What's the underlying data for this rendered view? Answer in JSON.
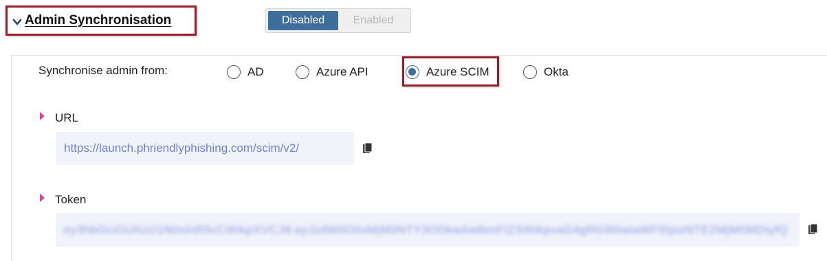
{
  "section": {
    "title": "Admin Synchronisation"
  },
  "toggle": {
    "options": [
      {
        "label": "Disabled",
        "selected": true
      },
      {
        "label": "Enabled",
        "selected": false
      }
    ],
    "active_color": "#3e6e9c"
  },
  "sync": {
    "label": "Synchronise admin from:",
    "options": [
      {
        "label": "AD",
        "selected": false
      },
      {
        "label": "Azure API",
        "selected": false
      },
      {
        "label": "Azure SCIM",
        "selected": true
      },
      {
        "label": "Okta",
        "selected": false
      }
    ]
  },
  "fields": {
    "url": {
      "label": "URL",
      "value": "https://launch.phriendlyphishing.com/scim/v2/",
      "copy_icon": "copy-icon"
    },
    "token": {
      "label": "Token",
      "value": "ey3hbGciOiJIUzI1NiIsInR5cCI6IkpXVCJ9.eyJzdWIiOiIxMjM0NTY3ODkwIiwibmFtZSI6IkpvaG4gRG9lIiwiaWF0IjoxNTE2MjM5MDIyfQ",
      "copy_icon": "copy-icon"
    }
  },
  "colors": {
    "highlight_border": "#9a1b2c",
    "caret": "#e0409a",
    "field_text": "#6e82c8",
    "field_bg": "#f1f3fb"
  }
}
